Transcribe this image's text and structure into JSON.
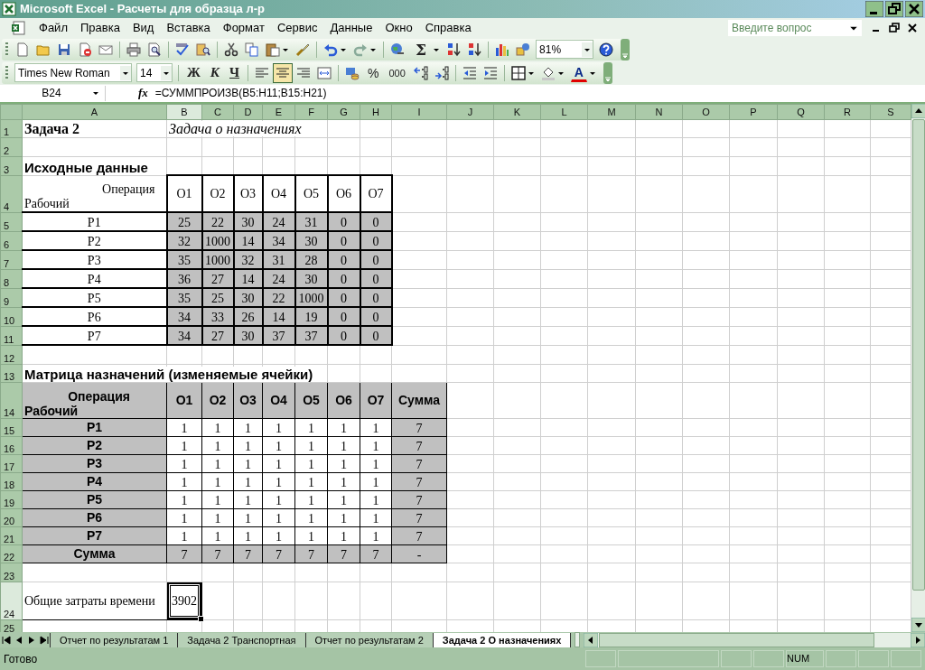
{
  "window": {
    "title": "Microsoft Excel - Расчеты для образца л-р"
  },
  "menu": [
    {
      "label": "Файл"
    },
    {
      "label": "Правка"
    },
    {
      "label": "Вид"
    },
    {
      "label": "Вставка"
    },
    {
      "label": "Формат"
    },
    {
      "label": "Сервис"
    },
    {
      "label": "Данные"
    },
    {
      "label": "Окно"
    },
    {
      "label": "Справка"
    }
  ],
  "help_box": {
    "placeholder": "Введите вопрос"
  },
  "standard_toolbar": [
    {
      "kind": "blank-page"
    },
    {
      "kind": "folder"
    },
    {
      "kind": "floppy-disk"
    },
    {
      "kind": "page-stop"
    },
    {
      "kind": "envelope"
    },
    {
      "kind": "separator"
    },
    {
      "kind": "printer"
    },
    {
      "kind": "page-magnifier"
    },
    {
      "kind": "separator"
    },
    {
      "kind": "spelling-check"
    },
    {
      "kind": "book-magnifier"
    },
    {
      "kind": "separator"
    },
    {
      "kind": "scissors"
    },
    {
      "kind": "copy-pages"
    },
    {
      "kind": "clipboard"
    },
    {
      "kind": "paintbrush"
    },
    {
      "kind": "separator"
    },
    {
      "kind": "undo-arrow"
    },
    {
      "kind": "redo-arrow"
    },
    {
      "kind": "separator"
    },
    {
      "kind": "globe-link"
    },
    {
      "kind": "sum",
      "label": "Σ"
    },
    {
      "kind": "sort-ascending"
    },
    {
      "kind": "sort-descending"
    },
    {
      "kind": "separator"
    },
    {
      "kind": "bar-chart"
    },
    {
      "kind": "drawing-shapes"
    },
    {
      "kind": "zoom",
      "label": "81%"
    },
    {
      "kind": "help-circle"
    }
  ],
  "formatting_toolbar": [
    {
      "kind": "font",
      "label": "Times New Roman"
    },
    {
      "kind": "size",
      "label": "14"
    },
    {
      "kind": "separator"
    },
    {
      "kind": "bold",
      "label": "Ж"
    },
    {
      "kind": "italic",
      "label": "К"
    },
    {
      "kind": "underline",
      "label": "Ч"
    },
    {
      "kind": "separator"
    },
    {
      "kind": "align-left",
      "selected": false
    },
    {
      "kind": "align-center",
      "selected": true
    },
    {
      "kind": "align-right",
      "selected": false
    },
    {
      "kind": "merge-center",
      "selected": false
    },
    {
      "kind": "separator"
    },
    {
      "kind": "coin-stack"
    },
    {
      "kind": "percent",
      "label": "%"
    },
    {
      "kind": "thousands",
      "label": "000"
    },
    {
      "kind": "more-decimals"
    },
    {
      "kind": "fewer-decimals"
    },
    {
      "kind": "separator"
    },
    {
      "kind": "outdent"
    },
    {
      "kind": "indent"
    },
    {
      "kind": "separator"
    },
    {
      "kind": "borders"
    },
    {
      "kind": "fill-bucket"
    },
    {
      "kind": "font-color",
      "label": "A"
    }
  ],
  "formula_bar": {
    "name_box": "B24",
    "fx": "fx",
    "formula": "=СУММПРОИЗВ(B5:H11;B15:H21)"
  },
  "sheet": {
    "columns": [
      {
        "label": "A",
        "selected": false
      },
      {
        "label": "B",
        "selected": true
      },
      {
        "label": "C",
        "selected": false
      },
      {
        "label": "D",
        "selected": false
      },
      {
        "label": "E",
        "selected": false
      },
      {
        "label": "F",
        "selected": false
      },
      {
        "label": "G",
        "selected": false
      },
      {
        "label": "H",
        "selected": false
      },
      {
        "label": "I",
        "selected": false
      },
      {
        "label": "J",
        "selected": false
      },
      {
        "label": "K",
        "selected": false
      },
      {
        "label": "L",
        "selected": false
      },
      {
        "label": "M",
        "selected": false
      },
      {
        "label": "N",
        "selected": false
      },
      {
        "label": "O",
        "selected": false
      },
      {
        "label": "P",
        "selected": false
      },
      {
        "label": "Q",
        "selected": false
      },
      {
        "label": "R",
        "selected": false
      },
      {
        "label": "S",
        "selected": false
      }
    ],
    "rows": [
      {
        "number": "1",
        "selected": false,
        "cells": [
          {
            "kind": "bold",
            "text": "Задача 2"
          },
          {
            "kind": "italic",
            "text": "Задача о назначениях"
          }
        ]
      },
      {
        "number": "2",
        "selected": false
      },
      {
        "number": "3",
        "selected": false,
        "cells": [
          {
            "kind": "heading",
            "text": "Исходные данные"
          }
        ]
      },
      {
        "number": "4",
        "selected": false,
        "cells": [
          {
            "kind": "corner1",
            "top": "Операция",
            "bottom": "Рабочий"
          },
          {
            "kind": "head1",
            "text": "O1"
          },
          {
            "kind": "head1",
            "text": "O2"
          },
          {
            "kind": "head1",
            "text": "O3"
          },
          {
            "kind": "head1",
            "text": "O4"
          },
          {
            "kind": "head1",
            "text": "O5"
          },
          {
            "kind": "head1",
            "text": "O6"
          },
          {
            "kind": "head1",
            "text": "O7"
          }
        ]
      },
      {
        "number": "5",
        "selected": false,
        "cells": [
          {
            "kind": "label1",
            "text": "P1"
          },
          {
            "kind": "val1",
            "text": "25"
          },
          {
            "kind": "val1",
            "text": "22"
          },
          {
            "kind": "val1",
            "text": "30"
          },
          {
            "kind": "val1",
            "text": "24"
          },
          {
            "kind": "val1",
            "text": "31"
          },
          {
            "kind": "val1",
            "text": "0"
          },
          {
            "kind": "val1",
            "text": "0"
          }
        ]
      },
      {
        "number": "6",
        "selected": false,
        "cells": [
          {
            "kind": "label1",
            "text": "P2"
          },
          {
            "kind": "val1",
            "text": "32"
          },
          {
            "kind": "val1",
            "text": "1000"
          },
          {
            "kind": "val1",
            "text": "14"
          },
          {
            "kind": "val1",
            "text": "34"
          },
          {
            "kind": "val1",
            "text": "30"
          },
          {
            "kind": "val1",
            "text": "0"
          },
          {
            "kind": "val1",
            "text": "0"
          }
        ]
      },
      {
        "number": "7",
        "selected": false,
        "cells": [
          {
            "kind": "label1",
            "text": "P3"
          },
          {
            "kind": "val1",
            "text": "35"
          },
          {
            "kind": "val1",
            "text": "1000"
          },
          {
            "kind": "val1",
            "text": "32"
          },
          {
            "kind": "val1",
            "text": "31"
          },
          {
            "kind": "val1",
            "text": "28"
          },
          {
            "kind": "val1",
            "text": "0"
          },
          {
            "kind": "val1",
            "text": "0"
          }
        ]
      },
      {
        "number": "8",
        "selected": false,
        "cells": [
          {
            "kind": "label1",
            "text": "P4"
          },
          {
            "kind": "val1",
            "text": "36"
          },
          {
            "kind": "val1",
            "text": "27"
          },
          {
            "kind": "val1",
            "text": "14"
          },
          {
            "kind": "val1",
            "text": "24"
          },
          {
            "kind": "val1",
            "text": "30"
          },
          {
            "kind": "val1",
            "text": "0"
          },
          {
            "kind": "val1",
            "text": "0"
          }
        ]
      },
      {
        "number": "9",
        "selected": false,
        "cells": [
          {
            "kind": "label1",
            "text": "P5"
          },
          {
            "kind": "val1",
            "text": "35"
          },
          {
            "kind": "val1",
            "text": "25"
          },
          {
            "kind": "val1",
            "text": "30"
          },
          {
            "kind": "val1",
            "text": "22"
          },
          {
            "kind": "val1",
            "text": "1000"
          },
          {
            "kind": "val1",
            "text": "0"
          },
          {
            "kind": "val1",
            "text": "0"
          }
        ]
      },
      {
        "number": "10",
        "selected": false,
        "cells": [
          {
            "kind": "label1",
            "text": "P6"
          },
          {
            "kind": "val1",
            "text": "34"
          },
          {
            "kind": "val1",
            "text": "33"
          },
          {
            "kind": "val1",
            "text": "26"
          },
          {
            "kind": "val1",
            "text": "14"
          },
          {
            "kind": "val1",
            "text": "19"
          },
          {
            "kind": "val1",
            "text": "0"
          },
          {
            "kind": "val1",
            "text": "0"
          }
        ]
      },
      {
        "number": "11",
        "selected": false,
        "cells": [
          {
            "kind": "label1",
            "text": "P7"
          },
          {
            "kind": "val1",
            "text": "34"
          },
          {
            "kind": "val1",
            "text": "27"
          },
          {
            "kind": "val1",
            "text": "30"
          },
          {
            "kind": "val1",
            "text": "37"
          },
          {
            "kind": "val1",
            "text": "37"
          },
          {
            "kind": "val1",
            "text": "0"
          },
          {
            "kind": "val1",
            "text": "0"
          }
        ]
      },
      {
        "number": "12",
        "selected": false
      },
      {
        "number": "13",
        "selected": false,
        "cells": [
          {
            "kind": "heading",
            "text": "Матрица назначений (изменяемые ячейки)"
          }
        ]
      },
      {
        "number": "14",
        "selected": false,
        "cells": [
          {
            "kind": "corner2",
            "top": "Операция",
            "bottom": "Рабочий"
          },
          {
            "kind": "head2",
            "text": "O1"
          },
          {
            "kind": "head2",
            "text": "O2"
          },
          {
            "kind": "head2",
            "text": "O3"
          },
          {
            "kind": "head2",
            "text": "O4"
          },
          {
            "kind": "head2",
            "text": "O5"
          },
          {
            "kind": "head2",
            "text": "O6"
          },
          {
            "kind": "head2",
            "text": "O7"
          },
          {
            "kind": "head2",
            "text": "Сумма"
          }
        ]
      },
      {
        "number": "15",
        "selected": false,
        "cells": [
          {
            "kind": "head2",
            "text": "P1"
          },
          {
            "kind": "val2",
            "text": "1"
          },
          {
            "kind": "val2",
            "text": "1"
          },
          {
            "kind": "val2",
            "text": "1"
          },
          {
            "kind": "val2",
            "text": "1"
          },
          {
            "kind": "val2",
            "text": "1"
          },
          {
            "kind": "val2",
            "text": "1"
          },
          {
            "kind": "val2",
            "text": "1"
          },
          {
            "kind": "sum2",
            "text": "7"
          }
        ]
      },
      {
        "number": "16",
        "selected": false,
        "cells": [
          {
            "kind": "head2",
            "text": "P2"
          },
          {
            "kind": "val2",
            "text": "1"
          },
          {
            "kind": "val2",
            "text": "1"
          },
          {
            "kind": "val2",
            "text": "1"
          },
          {
            "kind": "val2",
            "text": "1"
          },
          {
            "kind": "val2",
            "text": "1"
          },
          {
            "kind": "val2",
            "text": "1"
          },
          {
            "kind": "val2",
            "text": "1"
          },
          {
            "kind": "sum2",
            "text": "7"
          }
        ]
      },
      {
        "number": "17",
        "selected": false,
        "cells": [
          {
            "kind": "head2",
            "text": "P3"
          },
          {
            "kind": "val2",
            "text": "1"
          },
          {
            "kind": "val2",
            "text": "1"
          },
          {
            "kind": "val2",
            "text": "1"
          },
          {
            "kind": "val2",
            "text": "1"
          },
          {
            "kind": "val2",
            "text": "1"
          },
          {
            "kind": "val2",
            "text": "1"
          },
          {
            "kind": "val2",
            "text": "1"
          },
          {
            "kind": "sum2",
            "text": "7"
          }
        ]
      },
      {
        "number": "18",
        "selected": false,
        "cells": [
          {
            "kind": "head2",
            "text": "P4"
          },
          {
            "kind": "val2",
            "text": "1"
          },
          {
            "kind": "val2",
            "text": "1"
          },
          {
            "kind": "val2",
            "text": "1"
          },
          {
            "kind": "val2",
            "text": "1"
          },
          {
            "kind": "val2",
            "text": "1"
          },
          {
            "kind": "val2",
            "text": "1"
          },
          {
            "kind": "val2",
            "text": "1"
          },
          {
            "kind": "sum2",
            "text": "7"
          }
        ]
      },
      {
        "number": "19",
        "selected": false,
        "cells": [
          {
            "kind": "head2",
            "text": "P5"
          },
          {
            "kind": "val2",
            "text": "1"
          },
          {
            "kind": "val2",
            "text": "1"
          },
          {
            "kind": "val2",
            "text": "1"
          },
          {
            "kind": "val2",
            "text": "1"
          },
          {
            "kind": "val2",
            "text": "1"
          },
          {
            "kind": "val2",
            "text": "1"
          },
          {
            "kind": "val2",
            "text": "1"
          },
          {
            "kind": "sum2",
            "text": "7"
          }
        ]
      },
      {
        "number": "20",
        "selected": false,
        "cells": [
          {
            "kind": "head2",
            "text": "P6"
          },
          {
            "kind": "val2",
            "text": "1"
          },
          {
            "kind": "val2",
            "text": "1"
          },
          {
            "kind": "val2",
            "text": "1"
          },
          {
            "kind": "val2",
            "text": "1"
          },
          {
            "kind": "val2",
            "text": "1"
          },
          {
            "kind": "val2",
            "text": "1"
          },
          {
            "kind": "val2",
            "text": "1"
          },
          {
            "kind": "sum2",
            "text": "7"
          }
        ]
      },
      {
        "number": "21",
        "selected": false,
        "cells": [
          {
            "kind": "head2",
            "text": "P7"
          },
          {
            "kind": "val2",
            "text": "1"
          },
          {
            "kind": "val2",
            "text": "1"
          },
          {
            "kind": "val2",
            "text": "1"
          },
          {
            "kind": "val2",
            "text": "1"
          },
          {
            "kind": "val2",
            "text": "1"
          },
          {
            "kind": "val2",
            "text": "1"
          },
          {
            "kind": "val2",
            "text": "1"
          },
          {
            "kind": "sum2",
            "text": "7"
          }
        ]
      },
      {
        "number": "22",
        "selected": false,
        "cells": [
          {
            "kind": "head2",
            "text": "Сумма"
          },
          {
            "kind": "sum2",
            "text": "7"
          },
          {
            "kind": "sum2",
            "text": "7"
          },
          {
            "kind": "sum2",
            "text": "7"
          },
          {
            "kind": "sum2",
            "text": "7"
          },
          {
            "kind": "sum2",
            "text": "7"
          },
          {
            "kind": "sum2",
            "text": "7"
          },
          {
            "kind": "sum2",
            "text": "7"
          },
          {
            "kind": "sum2",
            "text": "-"
          }
        ]
      },
      {
        "number": "23",
        "selected": false
      },
      {
        "number": "24",
        "selected": true,
        "cells": [
          {
            "kind": "total-label",
            "text": "Общие затраты времени"
          },
          {
            "kind": "total",
            "text": "3902"
          }
        ]
      },
      {
        "number": "25",
        "selected": false
      }
    ]
  },
  "tabs": [
    {
      "label": "Отчет по результатам 1",
      "selected": false
    },
    {
      "label": "Задача 2 Транспортная",
      "selected": false
    },
    {
      "label": "Отчет по результатам 2",
      "selected": false
    },
    {
      "label": "Задача 2 О назначениях",
      "selected": true
    }
  ],
  "status_bar": {
    "text": "Готово",
    "indicator": "NUM"
  }
}
